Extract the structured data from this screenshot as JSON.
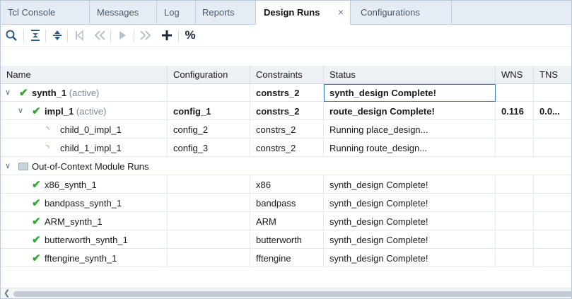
{
  "tabs": [
    {
      "label": "Tcl Console"
    },
    {
      "label": "Messages"
    },
    {
      "label": "Log"
    },
    {
      "label": "Reports"
    },
    {
      "label": "Design Runs",
      "active": true
    },
    {
      "label": "Configurations"
    }
  ],
  "tab_close_glyph": "×",
  "toolbar": {
    "icons": [
      "search-icon",
      "collapse-all-icon",
      "expand-all-icon",
      "first-icon",
      "previous-icon",
      "run-icon",
      "next-icon",
      "add-icon",
      "percent-icon"
    ],
    "percent_label": "%"
  },
  "columns": [
    "Name",
    "Configuration",
    "Constraints",
    "Status",
    "WNS",
    "TNS"
  ],
  "rows": [
    {
      "name": "synth_1",
      "suffix": "(active)",
      "config": "",
      "constraints": "constrs_2",
      "status": "synth_design Complete!",
      "wns": "",
      "tns": ""
    },
    {
      "name": "impl_1",
      "suffix": "(active)",
      "config": "config_1",
      "constraints": "constrs_2",
      "status": "route_design Complete!",
      "wns": "0.116",
      "tns": "0.0..."
    },
    {
      "name": "child_0_impl_1",
      "config": "config_2",
      "constraints": "constrs_2",
      "status": "Running place_design...",
      "wns": "",
      "tns": ""
    },
    {
      "name": "child_1_impl_1",
      "config": "config_3",
      "constraints": "constrs_2",
      "status": "Running route_design...",
      "wns": "",
      "tns": ""
    },
    {
      "name": "Out-of-Context Module Runs",
      "config": "",
      "constraints": "",
      "status": "",
      "wns": "",
      "tns": ""
    },
    {
      "name": "x86_synth_1",
      "config": "",
      "constraints": "x86",
      "status": "synth_design Complete!",
      "wns": "",
      "tns": ""
    },
    {
      "name": "bandpass_synth_1",
      "config": "",
      "constraints": "bandpass",
      "status": "synth_design Complete!",
      "wns": "",
      "tns": ""
    },
    {
      "name": "ARM_synth_1",
      "config": "",
      "constraints": "ARM",
      "status": "synth_design Complete!",
      "wns": "",
      "tns": ""
    },
    {
      "name": "butterworth_synth_1",
      "config": "",
      "constraints": "butterworth",
      "status": "synth_design Complete!",
      "wns": "",
      "tns": ""
    },
    {
      "name": "fftengine_synth_1",
      "config": "",
      "constraints": "fftengine",
      "status": "synth_design Complete!",
      "wns": "",
      "tns": ""
    }
  ],
  "colors": {
    "accent": "#2b5b8a",
    "check": "#2ea82e",
    "selection_border": "#3d7bc4"
  }
}
